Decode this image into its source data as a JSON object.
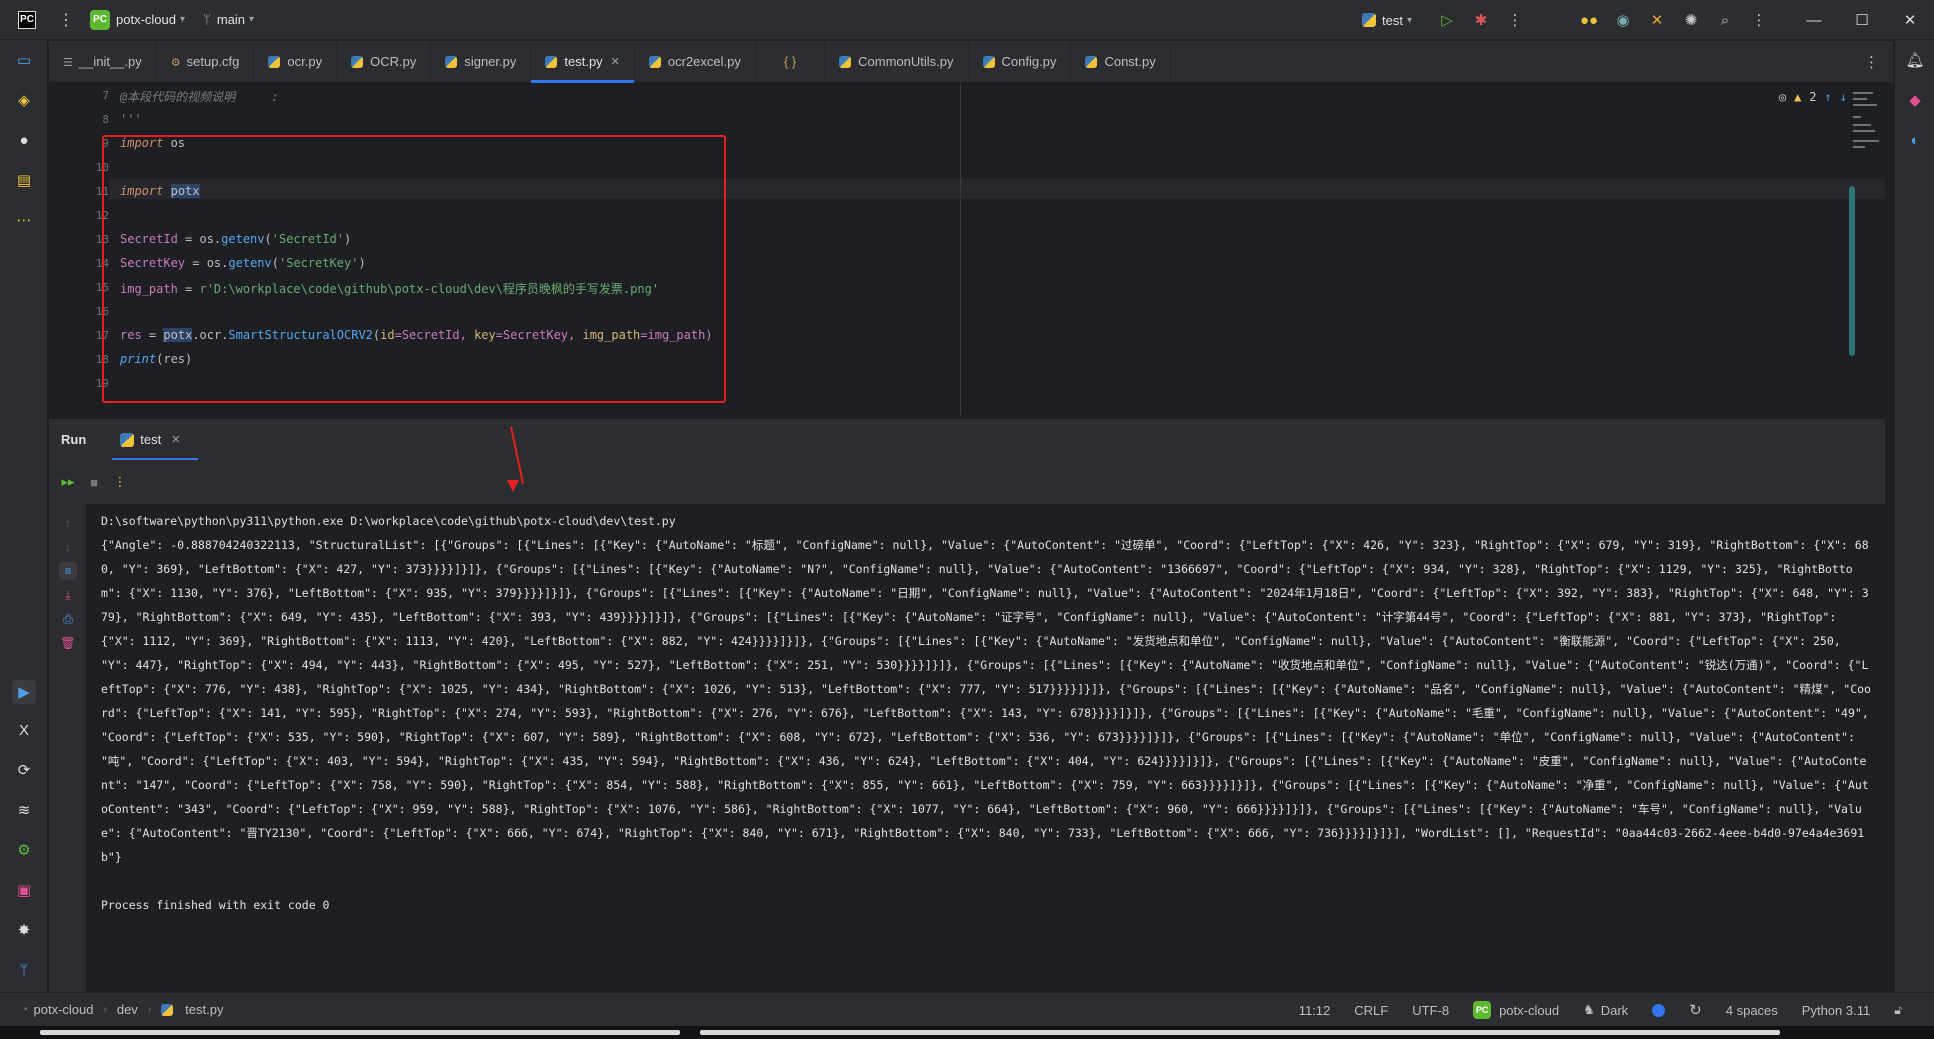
{
  "titlebar": {
    "project_badge": "PC",
    "project_name": "potx-cloud",
    "branch": "main",
    "run_config": "test"
  },
  "tabs": [
    {
      "label": "__init__.py",
      "icon": "python-init-icon"
    },
    {
      "label": "setup.cfg",
      "icon": "config-icon"
    },
    {
      "label": "ocr.py",
      "icon": "python-file-icon"
    },
    {
      "label": "OCR.py",
      "icon": "python-file-icon"
    },
    {
      "label": "signer.py",
      "icon": "python-file-icon"
    },
    {
      "label": "test.py",
      "icon": "python-file-icon",
      "active": true
    },
    {
      "label": "ocr2excel.py",
      "icon": "python-file-icon"
    },
    {
      "label": "{ }",
      "icon": "json-icon"
    },
    {
      "label": "CommonUtils.py",
      "icon": "python-file-icon"
    },
    {
      "label": "Config.py",
      "icon": "python-file-icon"
    },
    {
      "label": "Const.py",
      "icon": "python-file-icon"
    }
  ],
  "editor": {
    "line_numbers": [
      "7",
      "8",
      "9",
      "10",
      "11",
      "12",
      "13",
      "14",
      "15",
      "16",
      "17",
      "18",
      "19"
    ],
    "warnings_count": "2",
    "code": {
      "l7": "@本段代码的视频说明     :",
      "l8": "'''",
      "l9_kw": "import",
      "l9_mod": " os",
      "l11_kw": "import",
      "l11_mod": "potx",
      "l13_var": "SecretId",
      "l13_eq": " = os.",
      "l13_fn": "getenv",
      "l13_open": "(",
      "l13_str": "'SecretId'",
      "l13_close": ")",
      "l14_var": "SecretKey",
      "l14_eq": " = os.",
      "l14_fn": "getenv",
      "l14_open": "(",
      "l14_str": "'SecretKey'",
      "l14_close": ")",
      "l15_var": "img_path",
      "l15_eq": " = ",
      "l15_str": "r'D:\\workplace\\code\\github\\potx-cloud\\dev\\程序员晚枫的手写发票.png'",
      "l17_var": "res",
      "l17_eq": " = ",
      "l17_mod": "potx",
      "l17_dot": ".ocr.",
      "l17_fn": "SmartStructuralOCRV2",
      "l17_open": "(",
      "l17_p1": "id",
      "l17_v1": "=SecretId, ",
      "l17_p2": "key",
      "l17_v2": "=SecretKey, ",
      "l17_p3": "img_path",
      "l17_v3": "=img_path)",
      "l18_kw": "print",
      "l18_arg": "(res)"
    }
  },
  "run_panel": {
    "title": "Run",
    "tab_label": "test",
    "command": "D:\\software\\python\\py311\\python.exe D:\\workplace\\code\\github\\potx-cloud\\dev\\test.py",
    "output": "{\"Angle\": -0.888704240322113, \"StructuralList\": [{\"Groups\": [{\"Lines\": [{\"Key\": {\"AutoName\": \"标题\", \"ConfigName\": null}, \"Value\": {\"AutoContent\": \"过磅单\", \"Coord\": {\"LeftTop\": {\"X\": 426, \"Y\": 323}, \"RightTop\": {\"X\": 679, \"Y\": 319}, \"RightBottom\": {\"X\": 680, \"Y\": 369}, \"LeftBottom\": {\"X\": 427, \"Y\": 373}}}}]}]}, {\"Groups\": [{\"Lines\": [{\"Key\": {\"AutoName\": \"N?\", \"ConfigName\": null}, \"Value\": {\"AutoContent\": \"1366697\", \"Coord\": {\"LeftTop\": {\"X\": 934, \"Y\": 328}, \"RightTop\": {\"X\": 1129, \"Y\": 325}, \"RightBottom\": {\"X\": 1130, \"Y\": 376}, \"LeftBottom\": {\"X\": 935, \"Y\": 379}}}}]}]}, {\"Groups\": [{\"Lines\": [{\"Key\": {\"AutoName\": \"日期\", \"ConfigName\": null}, \"Value\": {\"AutoContent\": \"2024年1月18日\", \"Coord\": {\"LeftTop\": {\"X\": 392, \"Y\": 383}, \"RightTop\": {\"X\": 648, \"Y\": 379}, \"RightBottom\": {\"X\": 649, \"Y\": 435}, \"LeftBottom\": {\"X\": 393, \"Y\": 439}}}}]}]}, {\"Groups\": [{\"Lines\": [{\"Key\": {\"AutoName\": \"证字号\", \"ConfigName\": null}, \"Value\": {\"AutoContent\": \"计字第44号\", \"Coord\": {\"LeftTop\": {\"X\": 881, \"Y\": 373}, \"RightTop\": {\"X\": 1112, \"Y\": 369}, \"RightBottom\": {\"X\": 1113, \"Y\": 420}, \"LeftBottom\": {\"X\": 882, \"Y\": 424}}}}]}]}, {\"Groups\": [{\"Lines\": [{\"Key\": {\"AutoName\": \"发货地点和单位\", \"ConfigName\": null}, \"Value\": {\"AutoContent\": \"衡联能源\", \"Coord\": {\"LeftTop\": {\"X\": 250, \"Y\": 447}, \"RightTop\": {\"X\": 494, \"Y\": 443}, \"RightBottom\": {\"X\": 495, \"Y\": 527}, \"LeftBottom\": {\"X\": 251, \"Y\": 530}}}}]}]}, {\"Groups\": [{\"Lines\": [{\"Key\": {\"AutoName\": \"收货地点和单位\", \"ConfigName\": null}, \"Value\": {\"AutoContent\": \"锐达(万通)\", \"Coord\": {\"LeftTop\": {\"X\": 776, \"Y\": 438}, \"RightTop\": {\"X\": 1025, \"Y\": 434}, \"RightBottom\": {\"X\": 1026, \"Y\": 513}, \"LeftBottom\": {\"X\": 777, \"Y\": 517}}}}]}]}, {\"Groups\": [{\"Lines\": [{\"Key\": {\"AutoName\": \"品名\", \"ConfigName\": null}, \"Value\": {\"AutoContent\": \"精煤\", \"Coord\": {\"LeftTop\": {\"X\": 141, \"Y\": 595}, \"RightTop\": {\"X\": 274, \"Y\": 593}, \"RightBottom\": {\"X\": 276, \"Y\": 676}, \"LeftBottom\": {\"X\": 143, \"Y\": 678}}}}]}]}, {\"Groups\": [{\"Lines\": [{\"Key\": {\"AutoName\": \"毛重\", \"ConfigName\": null}, \"Value\": {\"AutoContent\": \"49\", \"Coord\": {\"LeftTop\": {\"X\": 535, \"Y\": 590}, \"RightTop\": {\"X\": 607, \"Y\": 589}, \"RightBottom\": {\"X\": 608, \"Y\": 672}, \"LeftBottom\": {\"X\": 536, \"Y\": 673}}}}]}]}, {\"Groups\": [{\"Lines\": [{\"Key\": {\"AutoName\": \"单位\", \"ConfigName\": null}, \"Value\": {\"AutoContent\": \"吨\", \"Coord\": {\"LeftTop\": {\"X\": 403, \"Y\": 594}, \"RightTop\": {\"X\": 435, \"Y\": 594}, \"RightBottom\": {\"X\": 436, \"Y\": 624}, \"LeftBottom\": {\"X\": 404, \"Y\": 624}}}}]}]}, {\"Groups\": [{\"Lines\": [{\"Key\": {\"AutoName\": \"皮重\", \"ConfigName\": null}, \"Value\": {\"AutoContent\": \"147\", \"Coord\": {\"LeftTop\": {\"X\": 758, \"Y\": 590}, \"RightTop\": {\"X\": 854, \"Y\": 588}, \"RightBottom\": {\"X\": 855, \"Y\": 661}, \"LeftBottom\": {\"X\": 759, \"Y\": 663}}}}]}]}, {\"Groups\": [{\"Lines\": [{\"Key\": {\"AutoName\": \"净重\", \"ConfigName\": null}, \"Value\": {\"AutoContent\": \"343\", \"Coord\": {\"LeftTop\": {\"X\": 959, \"Y\": 588}, \"RightTop\": {\"X\": 1076, \"Y\": 586}, \"RightBottom\": {\"X\": 1077, \"Y\": 664}, \"LeftBottom\": {\"X\": 960, \"Y\": 666}}}}]}]}, {\"Groups\": [{\"Lines\": [{\"Key\": {\"AutoName\": \"车号\", \"ConfigName\": null}, \"Value\": {\"AutoContent\": \"晋TY2130\", \"Coord\": {\"LeftTop\": {\"X\": 666, \"Y\": 674}, \"RightTop\": {\"X\": 840, \"Y\": 671}, \"RightBottom\": {\"X\": 840, \"Y\": 733}, \"LeftBottom\": {\"X\": 666, \"Y\": 736}}}}]}]}], \"WordList\": [], \"RequestId\": \"0aa44c03-2662-4eee-b4d0-97e4a4e3691b\"}",
    "exit_message": "Process finished with exit code 0"
  },
  "statusbar": {
    "breadcrumb": [
      "potx-cloud",
      "dev",
      "test.py"
    ],
    "cursor": "11:12",
    "line_sep": "CRLF",
    "encoding": "UTF-8",
    "project_badge": "PC",
    "project": "potx-cloud",
    "theme": "Dark",
    "indent": "4 spaces",
    "interpreter": "Python 3.11"
  },
  "colors": {
    "accent": "#3574f0",
    "highlight_box": "#e62020",
    "project_badge": "#5fb832"
  }
}
